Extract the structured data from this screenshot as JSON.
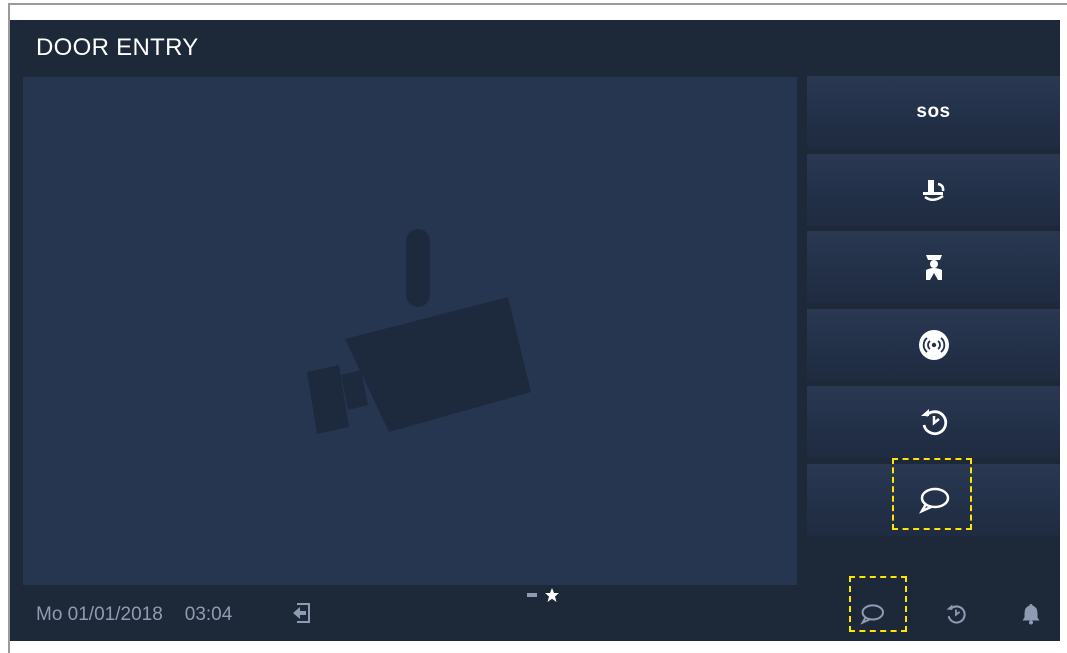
{
  "header": {
    "title": "DOOR ENTRY"
  },
  "video": {
    "placeholder_icon": "camera-icon"
  },
  "side_buttons": [
    {
      "name": "sos-button",
      "label": "sos"
    },
    {
      "name": "guard-unit-button",
      "icon": "phone-swirl-icon"
    },
    {
      "name": "caretaker-button",
      "icon": "caretaker-icon"
    },
    {
      "name": "broadcast-button",
      "icon": "broadcast-icon"
    },
    {
      "name": "history-button",
      "icon": "history-icon"
    },
    {
      "name": "message-button",
      "icon": "message-bubble-icon",
      "highlighted": true
    }
  ],
  "status_bar": {
    "date": "Mo 01/01/2018",
    "time": "03:04",
    "exit_icon": "exit-icon",
    "bottom_icons": [
      "message-bubble-icon",
      "history-icon",
      "bell-icon"
    ]
  },
  "pager": {
    "pages": 2,
    "current": 1
  },
  "colors": {
    "background": "#1d2839",
    "video": "#273650",
    "button": "#223048",
    "text": "#ffffff",
    "status_text": "#8e9cb3",
    "highlight": "#ffe600"
  }
}
